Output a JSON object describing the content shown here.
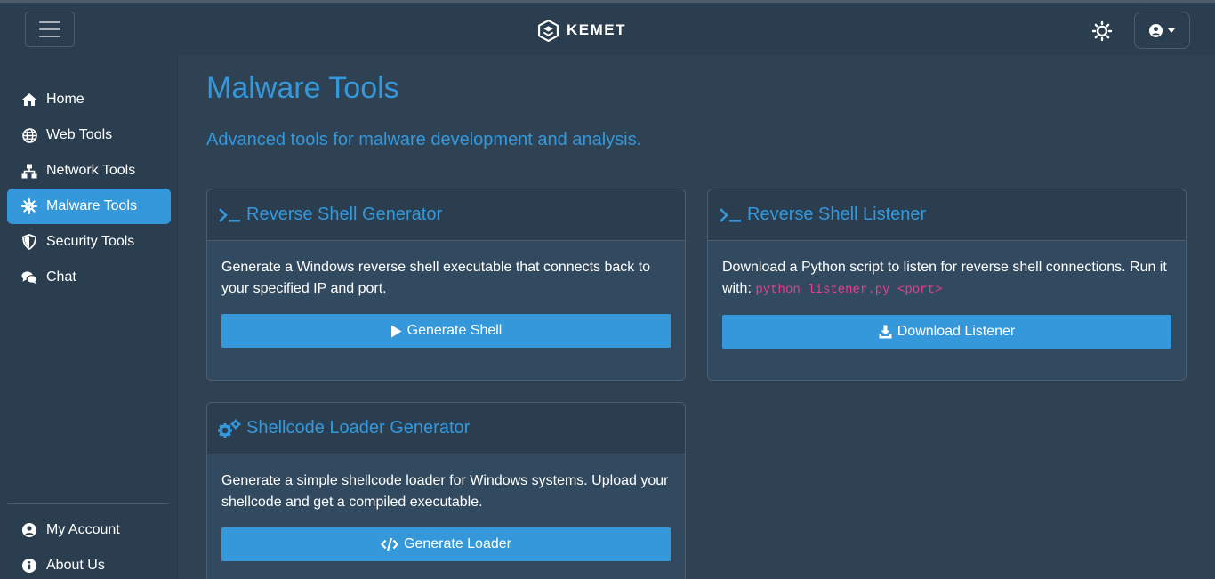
{
  "brand": {
    "name": "KEMET"
  },
  "sidebar": {
    "items": [
      {
        "label": "Home",
        "icon": "home-icon"
      },
      {
        "label": "Web Tools",
        "icon": "globe-icon"
      },
      {
        "label": "Network Tools",
        "icon": "network-icon"
      },
      {
        "label": "Malware Tools",
        "icon": "virus-icon",
        "active": true
      },
      {
        "label": "Security Tools",
        "icon": "shield-icon"
      },
      {
        "label": "Chat",
        "icon": "comments-icon"
      }
    ],
    "bottom_items": [
      {
        "label": "My Account",
        "icon": "user-circle-icon"
      },
      {
        "label": "About Us",
        "icon": "info-circle-icon"
      }
    ]
  },
  "page": {
    "title": "Malware Tools",
    "subtitle": "Advanced tools for malware development and analysis."
  },
  "cards": [
    {
      "title": "Reverse Shell Generator",
      "icon": "terminal-icon",
      "text": "Generate a Windows reverse shell executable that connects back to your specified IP and port.",
      "button": "Generate Shell",
      "button_icon": "play-icon"
    },
    {
      "title": "Reverse Shell Listener",
      "icon": "terminal-icon",
      "text": "Download a Python script to listen for reverse shell connections. Run it with: ",
      "code": "python listener.py <port>",
      "button": "Download Listener",
      "button_icon": "download-icon"
    },
    {
      "title": "Shellcode Loader Generator",
      "icon": "cogs-icon",
      "text": "Generate a simple shellcode loader for Windows systems. Upload your shellcode and get a compiled executable.",
      "button": "Generate Loader",
      "button_icon": "code-icon"
    }
  ],
  "colors": {
    "accent": "#3498db",
    "background": "#2b3e50",
    "code": "#e83e8c"
  }
}
